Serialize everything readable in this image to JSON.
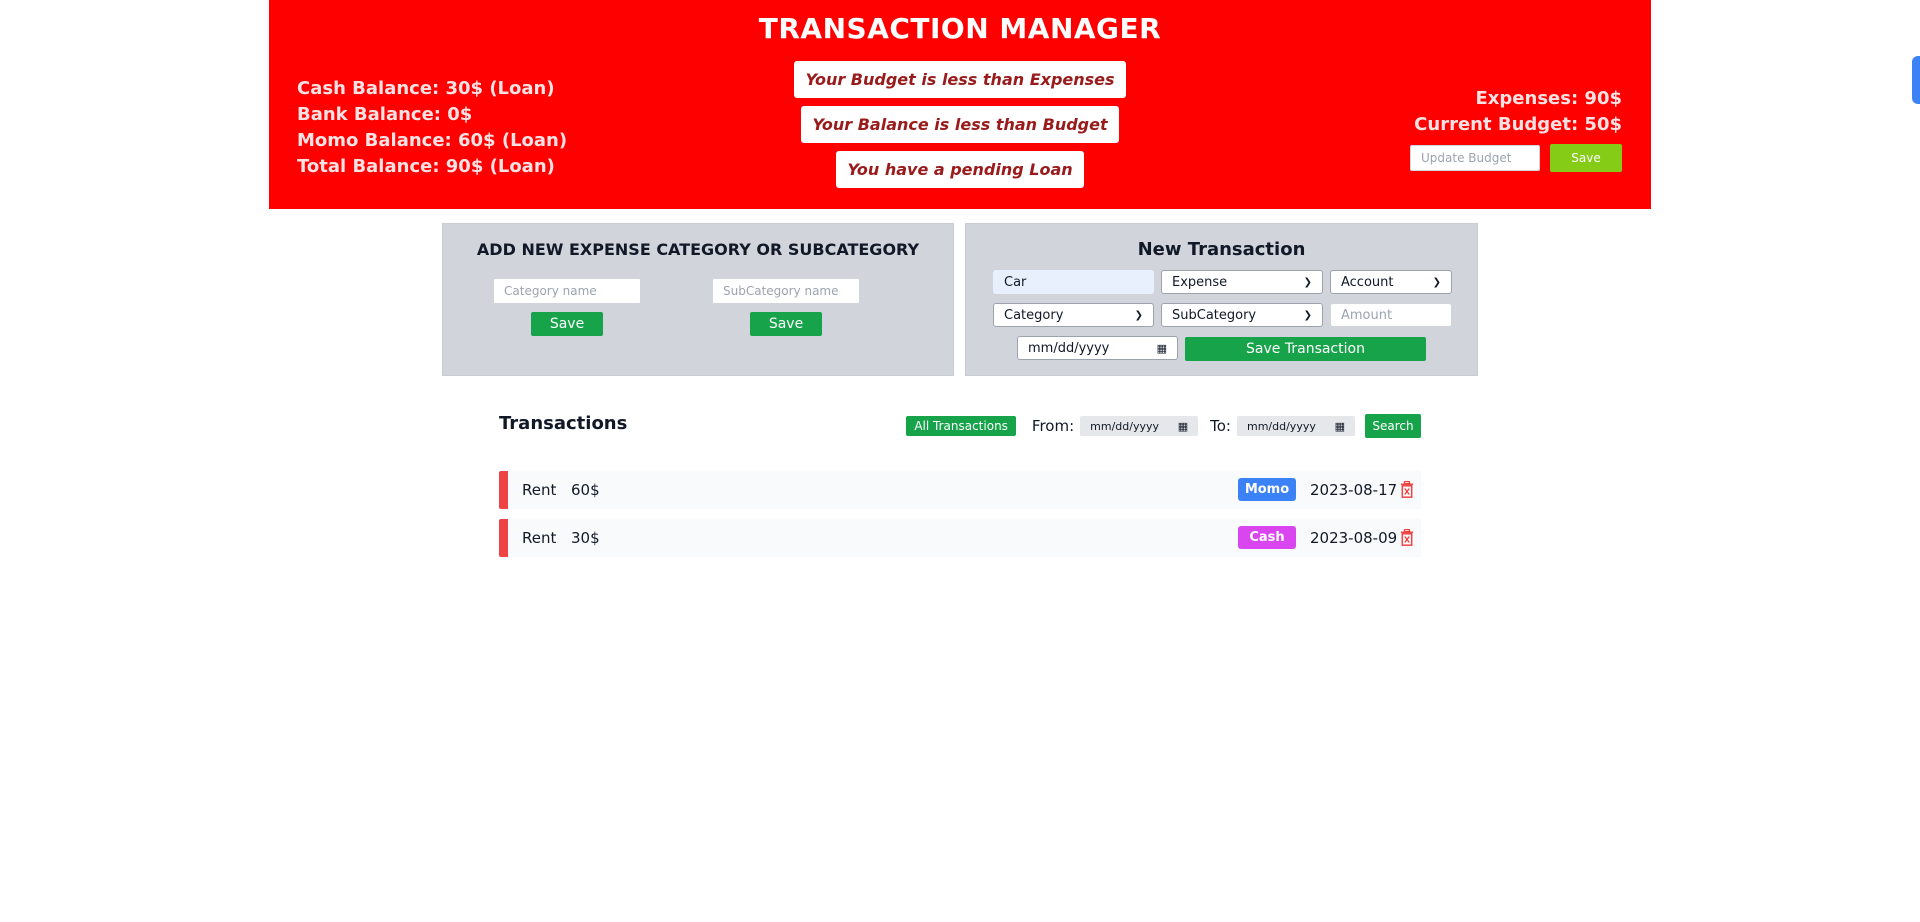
{
  "app": {
    "title": "TRANSACTION MANAGER"
  },
  "balances": [
    "Cash Balance: 30$ (Loan)",
    "Bank Balance: 0$",
    "Momo Balance: 60$ (Loan)",
    "Total Balance: 90$ (Loan)"
  ],
  "warnings": [
    "Your Budget is less than Expenses",
    "Your Balance is less than Budget",
    "You have a pending Loan"
  ],
  "budget": {
    "expenses": "Expenses: 90$",
    "current": "Current Budget: 50$",
    "input_placeholder": "Update Budget",
    "save_label": "Save"
  },
  "category_form": {
    "title": "ADD NEW EXPENSE CATEGORY OR SUBCATEGORY",
    "category_placeholder": "Category name",
    "subcategory_placeholder": "SubCategory name",
    "save_label": "Save"
  },
  "transaction_form": {
    "title": "New Transaction",
    "name_value": "Car",
    "type_value": "Expense",
    "account_value": "Account",
    "category_value": "Category",
    "subcategory_value": "SubCategory",
    "amount_placeholder": "Amount",
    "date_placeholder": "mm/dd/yyyy",
    "save_label": "Save Transaction"
  },
  "transactions": {
    "title": "Transactions",
    "all_label": "All Transactions",
    "from_label": "From:",
    "to_label": "To:",
    "date_placeholder": "mm/dd/yyyy",
    "search_label": "Search",
    "rows": [
      {
        "category": "Rent",
        "amount": "60$",
        "account": "Momo",
        "account_color": "#3b82f6",
        "date": "2023-08-17"
      },
      {
        "category": "Rent",
        "amount": "30$",
        "account": "Cash",
        "account_color": "#d946ef",
        "date": "2023-08-09"
      }
    ]
  },
  "icons": {
    "date": "calendar-icon",
    "select": "chevron-down-icon",
    "delete": "trash-icon"
  },
  "colors": {
    "header_bg": "#ff0000",
    "panel_bg": "#d1d5db",
    "primary_green": "#16a34a",
    "budget_save": "#84cc16",
    "danger": "#ef4444"
  }
}
